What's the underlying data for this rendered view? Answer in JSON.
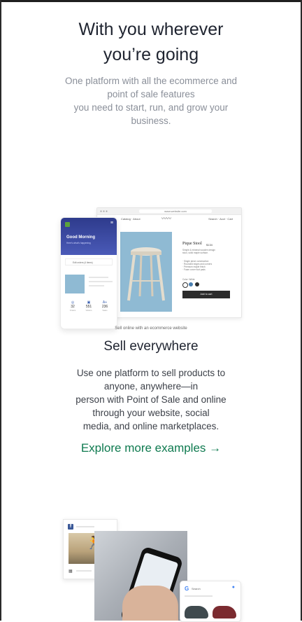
{
  "hero": {
    "title_line1": "With you wherever",
    "title_line2": "you’re going",
    "sub_line1": "One platform with all the ecommerce and",
    "sub_line2": "point of sale features",
    "sub_line3": "you need to start, run, and grow your",
    "sub_line4": "business."
  },
  "illustration": {
    "url": "www.website.com",
    "nav_left": "Catalog  ·  About",
    "nav_right": "Search  ·  Acct  ·  Cart",
    "product_title": "Pique Stool",
    "product_price": "$134",
    "product_desc": "Simple & minimal wooden design stool, solid maple surface.",
    "bullets": [
      "· Single piece construction",
      "· Rounded edges and corners",
      "· Premium maple finish",
      "· Foam cover foot pads"
    ],
    "color_label": "Color: White",
    "add_cart": "Add to cart",
    "swatch_colors": [
      "#ffffff",
      "#4a7fb0",
      "#2b2b2b"
    ],
    "phone_greeting": "Good Morning",
    "phone_greeting_sub": "Here's what's happening",
    "phone_row": "Edit orders (4 items)",
    "stats": [
      {
        "icon": "orders-icon",
        "num": "32",
        "lbl": "Orders"
      },
      {
        "icon": "visitors-icon",
        "num": "551",
        "lbl": "Visitors"
      },
      {
        "icon": "sales-icon",
        "num": "236",
        "lbl": "Sales"
      }
    ],
    "caption": "Sell online with an ecommerce website"
  },
  "section": {
    "title": "Sell everywhere",
    "body_line1": "Use one platform to sell products to",
    "body_line2": "anyone, anywhere—in",
    "body_line3": "person with Point of Sale and online",
    "body_line4": "through your website, social",
    "body_line5": "media, and online marketplaces.",
    "link": "Explore more examples →"
  },
  "collage": {
    "fb_letter": "f",
    "google_letter": "G",
    "google_search": "Search"
  },
  "colors": {
    "accent_green": "#0e7a4f",
    "heading": "#1f2430",
    "muted": "#8a8f99",
    "photo_blue": "#8fbad3",
    "phone_header": "#2e3b8c"
  }
}
